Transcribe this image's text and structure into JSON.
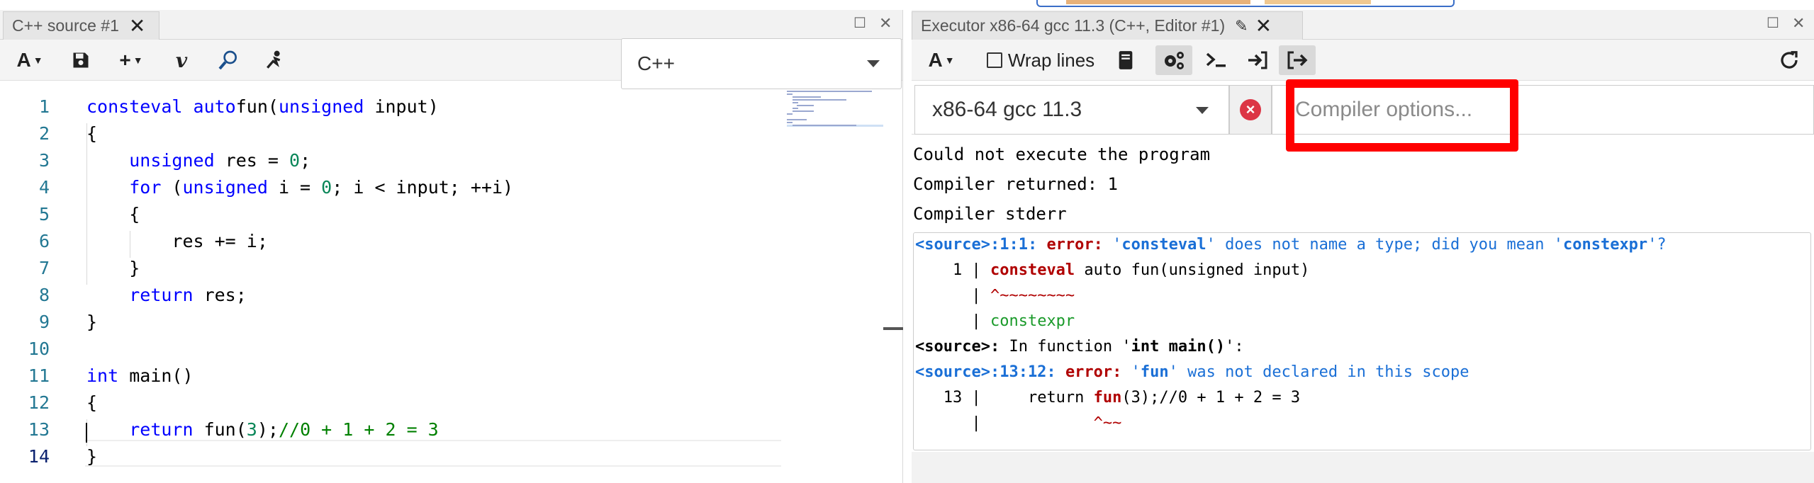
{
  "left_pane": {
    "tab_title": "C++ source #1",
    "language": "C++",
    "code": {
      "line_numbers": [
        "1",
        "2",
        "3",
        "4",
        "5",
        "6",
        "7",
        "8",
        "9",
        "10",
        "11",
        "12",
        "13",
        "14"
      ],
      "current_line": "14"
    }
  },
  "right_pane": {
    "tab_title": "Executor x86-64 gcc 11.3 (C++, Editor #1)",
    "wrap_lines_label": "Wrap lines",
    "compiler_name": "x86-64 gcc 11.3",
    "compiler_options_placeholder": "Compiler options...",
    "output": {
      "line1": "Could not execute the program",
      "line2": "Compiler returned: 1",
      "line3": "Compiler stderr"
    },
    "stderr": {
      "e1_loc": "<source>:1:1:",
      "e1_kind": "error:",
      "e1_msg_a": "'",
      "e1_ident": "consteval",
      "e1_msg_b": "' does not name a type; did you mean '",
      "e1_sugg": "constexpr",
      "e1_msg_c": "'?",
      "e1_lineno": "    1 | ",
      "e1_code_kw": "consteval",
      "e1_code_rest": " auto fun(unsigned input)",
      "e1_bar": "      | ",
      "e1_carets": "^~~~~~~~~",
      "e1_fix": "constexpr",
      "e2_loc": "<source>:",
      "e2_msg": " In function '",
      "e2_func": "int main()",
      "e2_end": "':",
      "e3_loc": "<source>:13:12:",
      "e3_kind": "error:",
      "e3_msg_a": "'",
      "e3_ident": "fun",
      "e3_msg_b": "' was not declared in this scope",
      "e3_lineno": "   13 | ",
      "e3_code_a": "    return ",
      "e3_code_fun": "fun",
      "e3_code_b": "(3);//0 + 1 + 2 = 3",
      "e3_carets": "^~~"
    }
  }
}
